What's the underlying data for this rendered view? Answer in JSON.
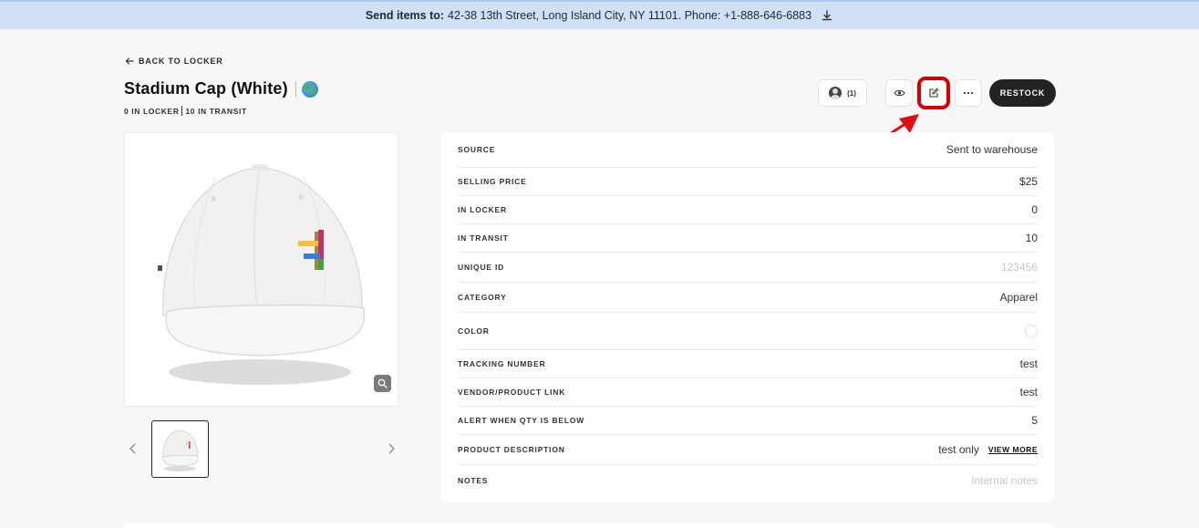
{
  "banner": {
    "label": "Send items to:",
    "address": "42-38 13th Street, Long Island City, NY 11101. Phone: +1-888-646-6883",
    "icon": "download-icon"
  },
  "nav": {
    "back_label": "BACK TO LOCKER"
  },
  "product": {
    "title": "Stadium Cap (White)",
    "in_locker_label": "0 IN LOCKER",
    "in_transit_label": "10 IN TRANSIT"
  },
  "actions": {
    "user_count": "(1)",
    "restock_label": "RESTOCK"
  },
  "details": [
    {
      "label": "SOURCE",
      "value": "Sent to warehouse"
    },
    {
      "label": "SELLING PRICE",
      "value": "$25"
    },
    {
      "label": "IN LOCKER",
      "value": "0"
    },
    {
      "label": "IN TRANSIT",
      "value": "10"
    },
    {
      "label": "UNIQUE ID",
      "value": "123456"
    },
    {
      "label": "CATEGORY",
      "value": "Apparel"
    },
    {
      "label": "COLOR",
      "value": ""
    },
    {
      "label": "TRACKING NUMBER",
      "value": "test"
    },
    {
      "label": "VENDOR/PRODUCT LINK",
      "value": "test"
    },
    {
      "label": "ALERT WHEN QTY IS BELOW",
      "value": "5"
    },
    {
      "label": "PRODUCT DESCRIPTION",
      "value": "test only",
      "link": "VIEW MORE"
    },
    {
      "label": "NOTES",
      "value": "Internal notes"
    }
  ],
  "colors": {
    "banner_bg": "#cfe0f7",
    "highlight": "#d40000",
    "restock_bg": "#222222"
  }
}
